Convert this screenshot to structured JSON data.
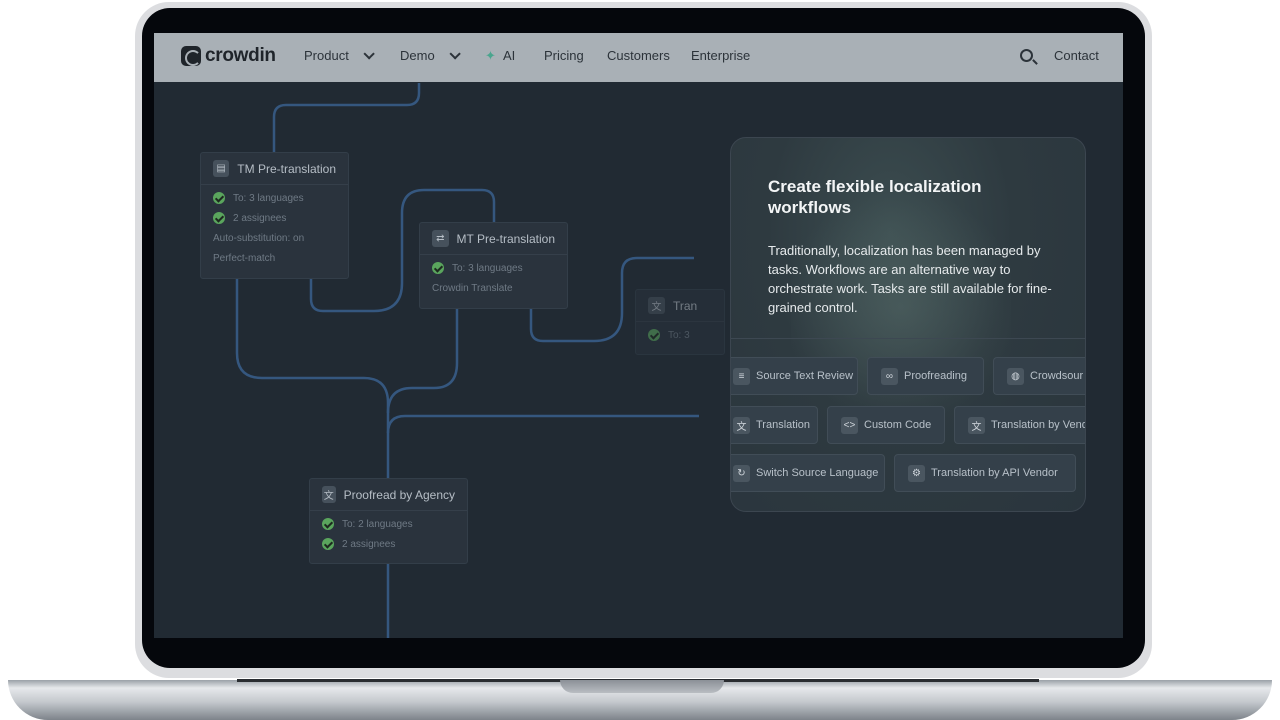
{
  "nav": {
    "brand": "crowdin",
    "items": [
      "Product",
      "Demo",
      "AI",
      "Pricing",
      "Customers",
      "Enterprise"
    ],
    "contact": "Contact"
  },
  "flow": {
    "tm_card": {
      "title": "TM Pre-translation",
      "rows": [
        "To: 3 languages",
        "2 assignees"
      ],
      "notes": [
        "Auto-substitution: on",
        "Perfect-match"
      ]
    },
    "mt_card": {
      "title": "MT Pre-translation",
      "rows": [
        "To: 3 languages"
      ],
      "notes": [
        "Crowdin Translate"
      ]
    },
    "tr_card": {
      "title": "Tran",
      "rows": [
        "To: 3"
      ]
    },
    "agency_card": {
      "title": "Proofread by Agency",
      "rows": [
        "To: 2 languages",
        "2 assignees"
      ]
    }
  },
  "panel": {
    "title": "Create flexible localization workflows",
    "text": "Traditionally, localization has been managed by tasks. Workflows are an alternative way to orchestrate work. Tasks are still available for fine-grained control.",
    "chips": [
      "Source Text Review",
      "Proofreading",
      "Crowdsour",
      "Translation",
      "Custom Code",
      "Translation by Vend",
      "Switch Source Language",
      "Translation by API Vendor"
    ]
  }
}
